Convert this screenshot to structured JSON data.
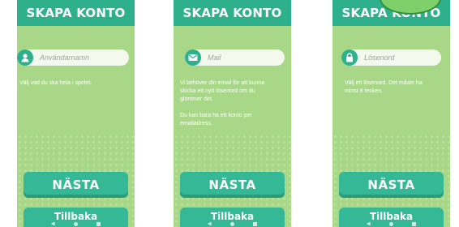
{
  "screens": [
    {
      "title": "SKAPA KONTO",
      "field": {
        "icon": "user-icon",
        "placeholder": "Användarnamn"
      },
      "hint": [
        "Välj vad du ska heta i spelet."
      ],
      "next_label": "NÄSTA",
      "back_label": "Tillbaka"
    },
    {
      "title": "SKAPA KONTO",
      "field": {
        "icon": "mail-icon",
        "placeholder": "Mail"
      },
      "hint": [
        "Vi behöver din email för att kunna skicka ett nytt lösenord om du glömmer det.",
        "Du kan bara ha ett konto per emailadress."
      ],
      "next_label": "NÄSTA",
      "back_label": "Tillbaka"
    },
    {
      "title": "SKAPA KONTO",
      "field": {
        "icon": "lock-icon",
        "placeholder": "Lösenord"
      },
      "hint": [
        "Välj ett lösenord. Det måste ha minst 8 tecken."
      ],
      "next_label": "NÄSTA",
      "back_label": "Tillbaka"
    }
  ],
  "colors": {
    "background": "#a8d887",
    "header": "#2eb08d",
    "button": "#34b896",
    "field": "#f4f9ee"
  }
}
